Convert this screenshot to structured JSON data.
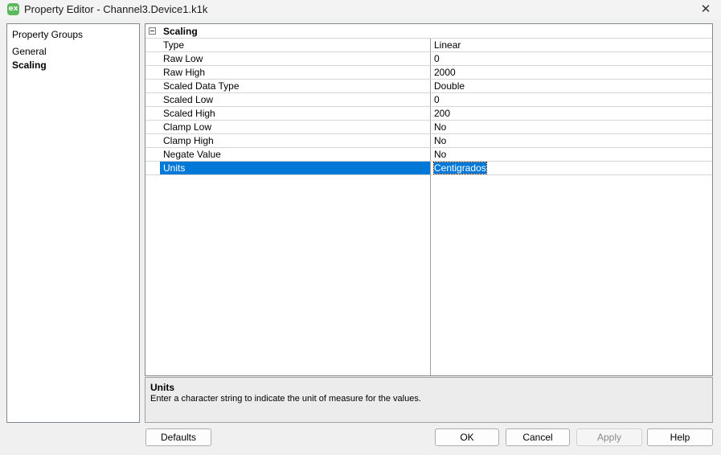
{
  "window": {
    "title": "Property Editor - Channel3.Device1.k1k",
    "app_icon_label": "ex",
    "close_symbol": "✕"
  },
  "groups": {
    "header": "Property Groups",
    "items": [
      {
        "label": "General",
        "selected": false
      },
      {
        "label": "Scaling",
        "selected": true
      }
    ]
  },
  "grid": {
    "category": "Scaling",
    "properties": [
      {
        "name": "Type",
        "value": "Linear"
      },
      {
        "name": "Raw Low",
        "value": "0"
      },
      {
        "name": "Raw High",
        "value": "2000"
      },
      {
        "name": "Scaled Data Type",
        "value": "Double"
      },
      {
        "name": "Scaled Low",
        "value": "0"
      },
      {
        "name": "Scaled High",
        "value": "200"
      },
      {
        "name": "Clamp Low",
        "value": "No"
      },
      {
        "name": "Clamp High",
        "value": "No"
      },
      {
        "name": "Negate Value",
        "value": "No"
      },
      {
        "name": "Units",
        "value": "Centigrados",
        "selected": true
      }
    ]
  },
  "description": {
    "title": "Units",
    "text": "Enter a character string to indicate the unit of measure for the values."
  },
  "buttons": {
    "defaults": "Defaults",
    "ok": "OK",
    "cancel": "Cancel",
    "apply": "Apply",
    "help": "Help"
  },
  "colors": {
    "selection": "#0078d7",
    "app_icon": "#5cb85c"
  }
}
